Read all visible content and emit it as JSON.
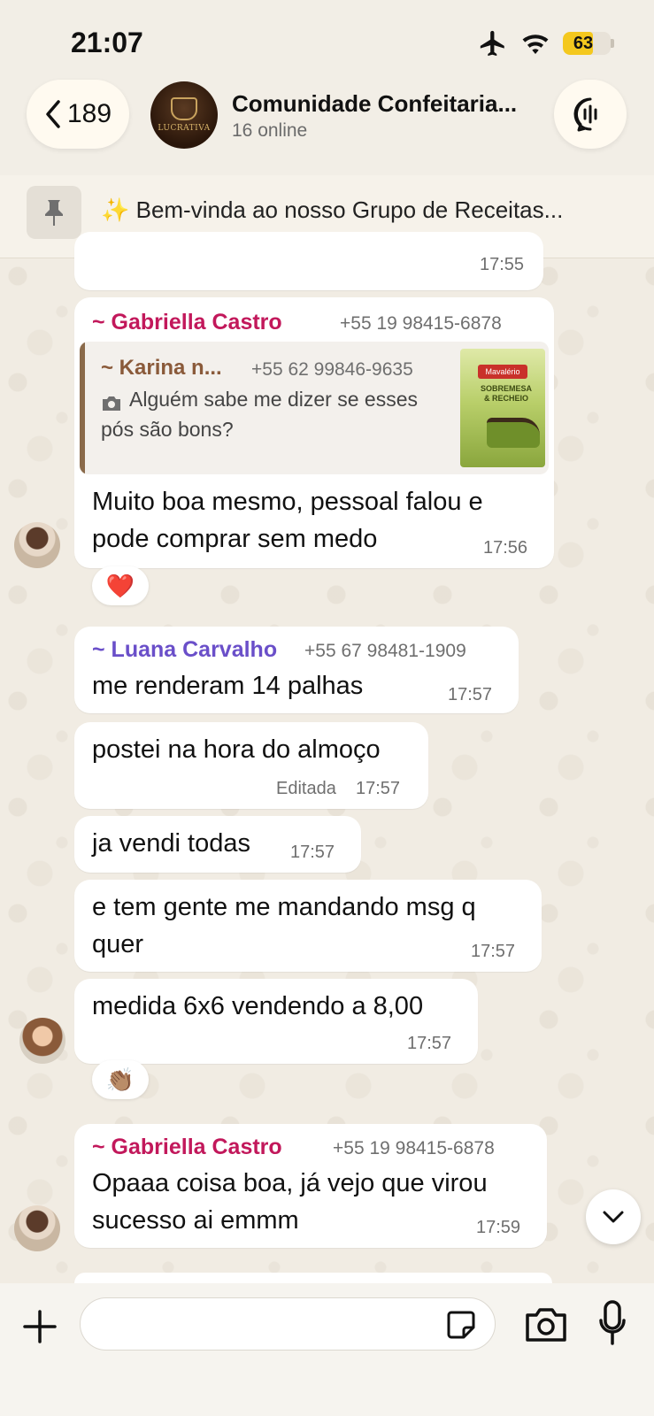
{
  "status": {
    "time": "21:07",
    "battery": "63",
    "battery_level": 0.63
  },
  "header": {
    "back_count": "189",
    "group_name": "Comunidade Confeitaria...",
    "online": "16 online",
    "avatar_label": "LUCRATIVA"
  },
  "pinned": {
    "text": "✨ Bem-vinda ao nosso Grupo de Receitas..."
  },
  "messages": {
    "m0": {
      "time": "17:55"
    },
    "m1": {
      "sender": "~ Gabriella Castro",
      "phone": "+55 19 98415-6878",
      "quote_sender": "~ Karina n...",
      "quote_phone": "+55 62 99846-9635",
      "quote_line1": "Alguém sabe me dizer se esses",
      "quote_line2": "pós são bons?",
      "quote_image_brand": "Mavalério",
      "quote_image_text": "SOBREMESA & RECHEIO",
      "line1": "Muito boa mesmo, pessoal falou e",
      "line2": "pode comprar sem medo",
      "time": "17:56",
      "reaction": "❤️"
    },
    "m2": {
      "sender": "~ Luana Carvalho",
      "phone": "+55 67 98481-1909",
      "text": "me renderam 14 palhas",
      "time": "17:57"
    },
    "m3": {
      "text": "postei na hora do almoço",
      "edited": "Editada",
      "time": "17:57"
    },
    "m4": {
      "text": "ja vendi todas",
      "time": "17:57"
    },
    "m5": {
      "line1": "e tem gente me mandando msg q",
      "line2": "quer",
      "time": "17:57"
    },
    "m6": {
      "text": "medida 6x6 vendendo a 8,00",
      "time": "17:57",
      "reaction": "👏🏽"
    },
    "m7": {
      "sender": "~ Gabriella Castro",
      "phone": "+55 19 98415-6878",
      "line1": "Opaaa coisa boa, já vejo que virou",
      "line2": "sucesso ai emmm",
      "time": "17:59"
    }
  },
  "input": {
    "value": "",
    "placeholder": ""
  },
  "colors": {
    "gabriella": "#c2185b",
    "karina": "#8a5a3a",
    "luana": "#6a4fc9",
    "battery_fill": "#f4c81e"
  },
  "icons": {
    "plane": "airplane-icon",
    "wifi": "wifi-icon",
    "back": "chevron-left-icon",
    "call": "audio-call-icon",
    "pin": "pin-icon",
    "camera_small": "camera-icon",
    "scroll": "chevron-down-icon",
    "plus": "plus-icon",
    "sticker": "sticker-icon",
    "camera": "camera-icon",
    "mic": "microphone-icon"
  }
}
